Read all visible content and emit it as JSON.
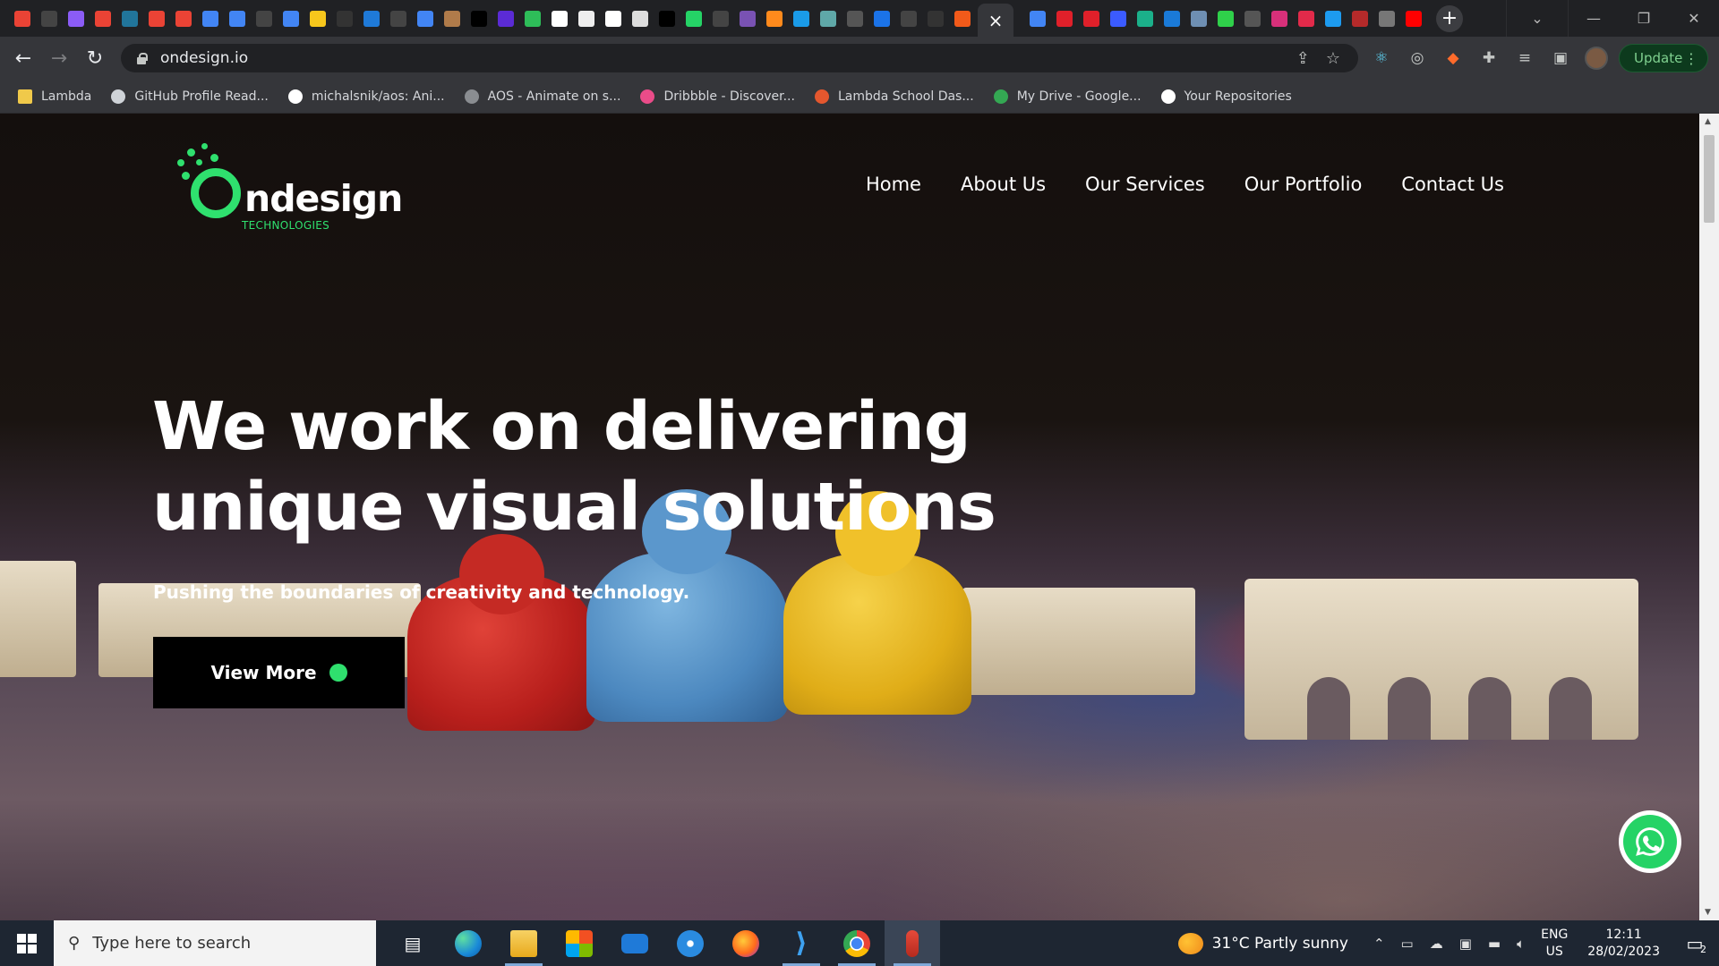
{
  "browser": {
    "tab_count_favicons": [
      "gmail",
      "github",
      "hashnode",
      "gmail",
      "wordpress",
      "gmail",
      "gmail",
      "docs",
      "docs",
      "github",
      "docs",
      "shield",
      "blank",
      "vscode-dev",
      "github",
      "docs",
      "book",
      "dev",
      "lorem",
      "notion-green",
      "cf",
      "image",
      "google",
      "screen",
      "io",
      "whatsapp",
      "github",
      "bootstrap",
      "orange",
      "play",
      "atom",
      "circle",
      "target",
      "github",
      "vercel",
      "cp"
    ],
    "right_tabs_favicons": [
      "docs",
      "red-star",
      "red-star",
      "blue-app",
      "screenshot",
      "butterfly",
      "mail",
      "sprout",
      "circle",
      "S",
      "heart",
      "twitter",
      "red",
      "audio",
      "youtube"
    ],
    "active_tab_close": "×",
    "new_tab": "+",
    "url": "ondesign.io",
    "update_label": "Update",
    "bookmarks": [
      {
        "label": "Lambda",
        "color": "#f0c94a"
      },
      {
        "label": "GitHub Profile Read...",
        "color": "#cfd3d8"
      },
      {
        "label": "michalsnik/aos: Ani...",
        "color": "#ffffff"
      },
      {
        "label": "AOS - Animate on s...",
        "color": "#8a8d91"
      },
      {
        "label": "Dribbble - Discover...",
        "color": "#ea4c89"
      },
      {
        "label": "Lambda School Das...",
        "color": "#e4572e"
      },
      {
        "label": "My Drive - Google...",
        "color": "#34a853"
      },
      {
        "label": "Your Repositories",
        "color": "#ffffff"
      }
    ]
  },
  "site": {
    "logo_word": "ndesign",
    "logo_sub": "TECHNOLOGIES",
    "nav": [
      "Home",
      "About Us",
      "Our Services",
      "Our Portfolio",
      "Contact Us"
    ],
    "hero_line1": "We work on delivering",
    "hero_line2": "unique visual solutions",
    "hero_sub": "Pushing the boundaries of creativity and technology.",
    "cta_label": "View More",
    "accent": "#2fe06e"
  },
  "taskbar": {
    "search_placeholder": "Type here to search",
    "apps": [
      "task-view",
      "edge",
      "file-explorer",
      "store",
      "mail",
      "safari-like",
      "firefox",
      "vscode",
      "chrome",
      "app"
    ],
    "weather": "31°C  Partly sunny",
    "lang_line1": "ENG",
    "lang_line2": "US",
    "time": "12:11",
    "date": "28/02/2023",
    "notifications": "2"
  }
}
